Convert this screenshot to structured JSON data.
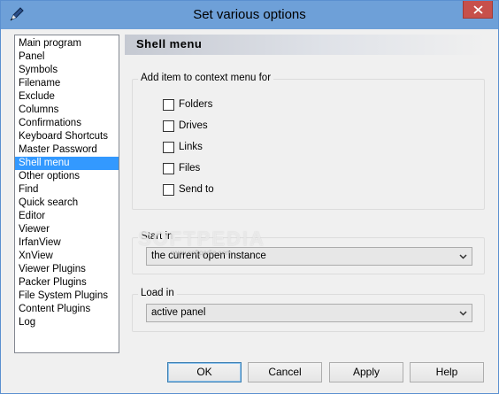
{
  "window": {
    "title": "Set various options"
  },
  "nav": {
    "items": [
      "Main program",
      "Panel",
      "Symbols",
      "Filename",
      "Exclude",
      "Columns",
      "Confirmations",
      "Keyboard Shortcuts",
      "Master Password",
      "Shell menu",
      "Other options",
      "Find",
      "Quick search",
      "Editor",
      "Viewer",
      "IrfanView",
      "XnView",
      "Viewer Plugins",
      "Packer Plugins",
      "File System Plugins",
      "Content Plugins",
      "Log"
    ],
    "selected": "Shell menu"
  },
  "section": {
    "title": "Shell menu"
  },
  "context_group": {
    "label": "Add  item to context menu for",
    "options": [
      {
        "label": "Folders",
        "checked": false
      },
      {
        "label": "Drives",
        "checked": false
      },
      {
        "label": "Links",
        "checked": false
      },
      {
        "label": "Files",
        "checked": false
      },
      {
        "label": "Send to",
        "checked": false
      }
    ]
  },
  "start_in": {
    "label": "Start in",
    "value": "the current open instance"
  },
  "load_in": {
    "label": "Load in",
    "value": "active panel"
  },
  "watermark": {
    "text": "SOFTPEDIA",
    "sub": "www.softpedia.com"
  },
  "buttons": {
    "ok": "OK",
    "cancel": "Cancel",
    "apply": "Apply",
    "help": "Help"
  }
}
